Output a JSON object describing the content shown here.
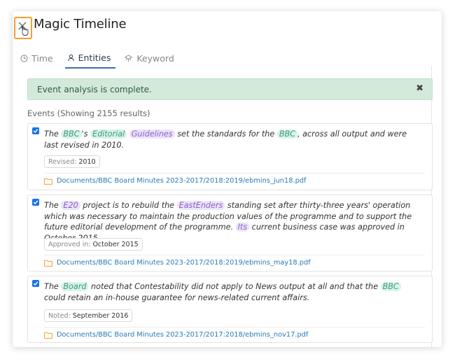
{
  "window": {
    "title": "Magic Timeline"
  },
  "tabs": [
    {
      "label": "Time",
      "icon": "clock-icon",
      "active": false
    },
    {
      "label": "Entities",
      "icon": "user-icon",
      "active": true
    },
    {
      "label": "Keyword",
      "icon": "keyword-icon",
      "active": false
    }
  ],
  "alert": {
    "message": "Event analysis is complete.",
    "close_glyph": "✖"
  },
  "events": {
    "header": "Events (Showing 2155 results)",
    "items": [
      {
        "checked": true,
        "segments": [
          {
            "t": "The "
          },
          {
            "t": "BBC",
            "e": "teal"
          },
          {
            "t": "'s "
          },
          {
            "t": "Editorial",
            "e": "teal"
          },
          {
            "t": " "
          },
          {
            "t": "Guidelines",
            "e": "purple"
          },
          {
            "t": " set the standards for the "
          },
          {
            "t": "BBC",
            "e": "teal"
          },
          {
            "t": ", across all output and were last revised in 2010."
          }
        ],
        "date_label": "Revised:",
        "date_value": "2010",
        "doc": "Documents/BBC Board Minutes 2023-2017/2018:2019/ebmins_jun18.pdf"
      },
      {
        "checked": true,
        "segments": [
          {
            "t": "The "
          },
          {
            "t": "E20",
            "e": "purple"
          },
          {
            "t": " project is to rebuild the "
          },
          {
            "t": "EastEnders",
            "e": "purple"
          },
          {
            "t": " standing set after thirty-three years' operation which was necessary to maintain the production values of the programme and to support the future editorial development of the programme. "
          },
          {
            "t": "Its",
            "e": "purple"
          },
          {
            "t": " current business case was approved in October 2015."
          }
        ],
        "date_label": "Approved in:",
        "date_value": "October 2015",
        "doc": "Documents/BBC Board Minutes 2023-2017/2018:2019/ebmins_may18.pdf"
      },
      {
        "checked": true,
        "segments": [
          {
            "t": "The "
          },
          {
            "t": "Board",
            "e": "teal"
          },
          {
            "t": " noted that Contestability did not apply to News output at all and that the "
          },
          {
            "t": "BBC",
            "e": "teal"
          },
          {
            "t": " could retain an in-house guarantee for news-related current affairs."
          }
        ],
        "date_label": "Noted:",
        "date_value": "September 2016",
        "doc": "Documents/BBC Board Minutes 2023-2017/2017:2018/ebmins_nov17.pdf"
      }
    ]
  },
  "colors": {
    "accent": "#1a73e8",
    "highlight_outline": "#f0a030",
    "alert_bg": "#d3eadb",
    "entity_teal": "#3b9a7d",
    "entity_purple": "#8a5fc7",
    "link": "#2a7ab8"
  }
}
